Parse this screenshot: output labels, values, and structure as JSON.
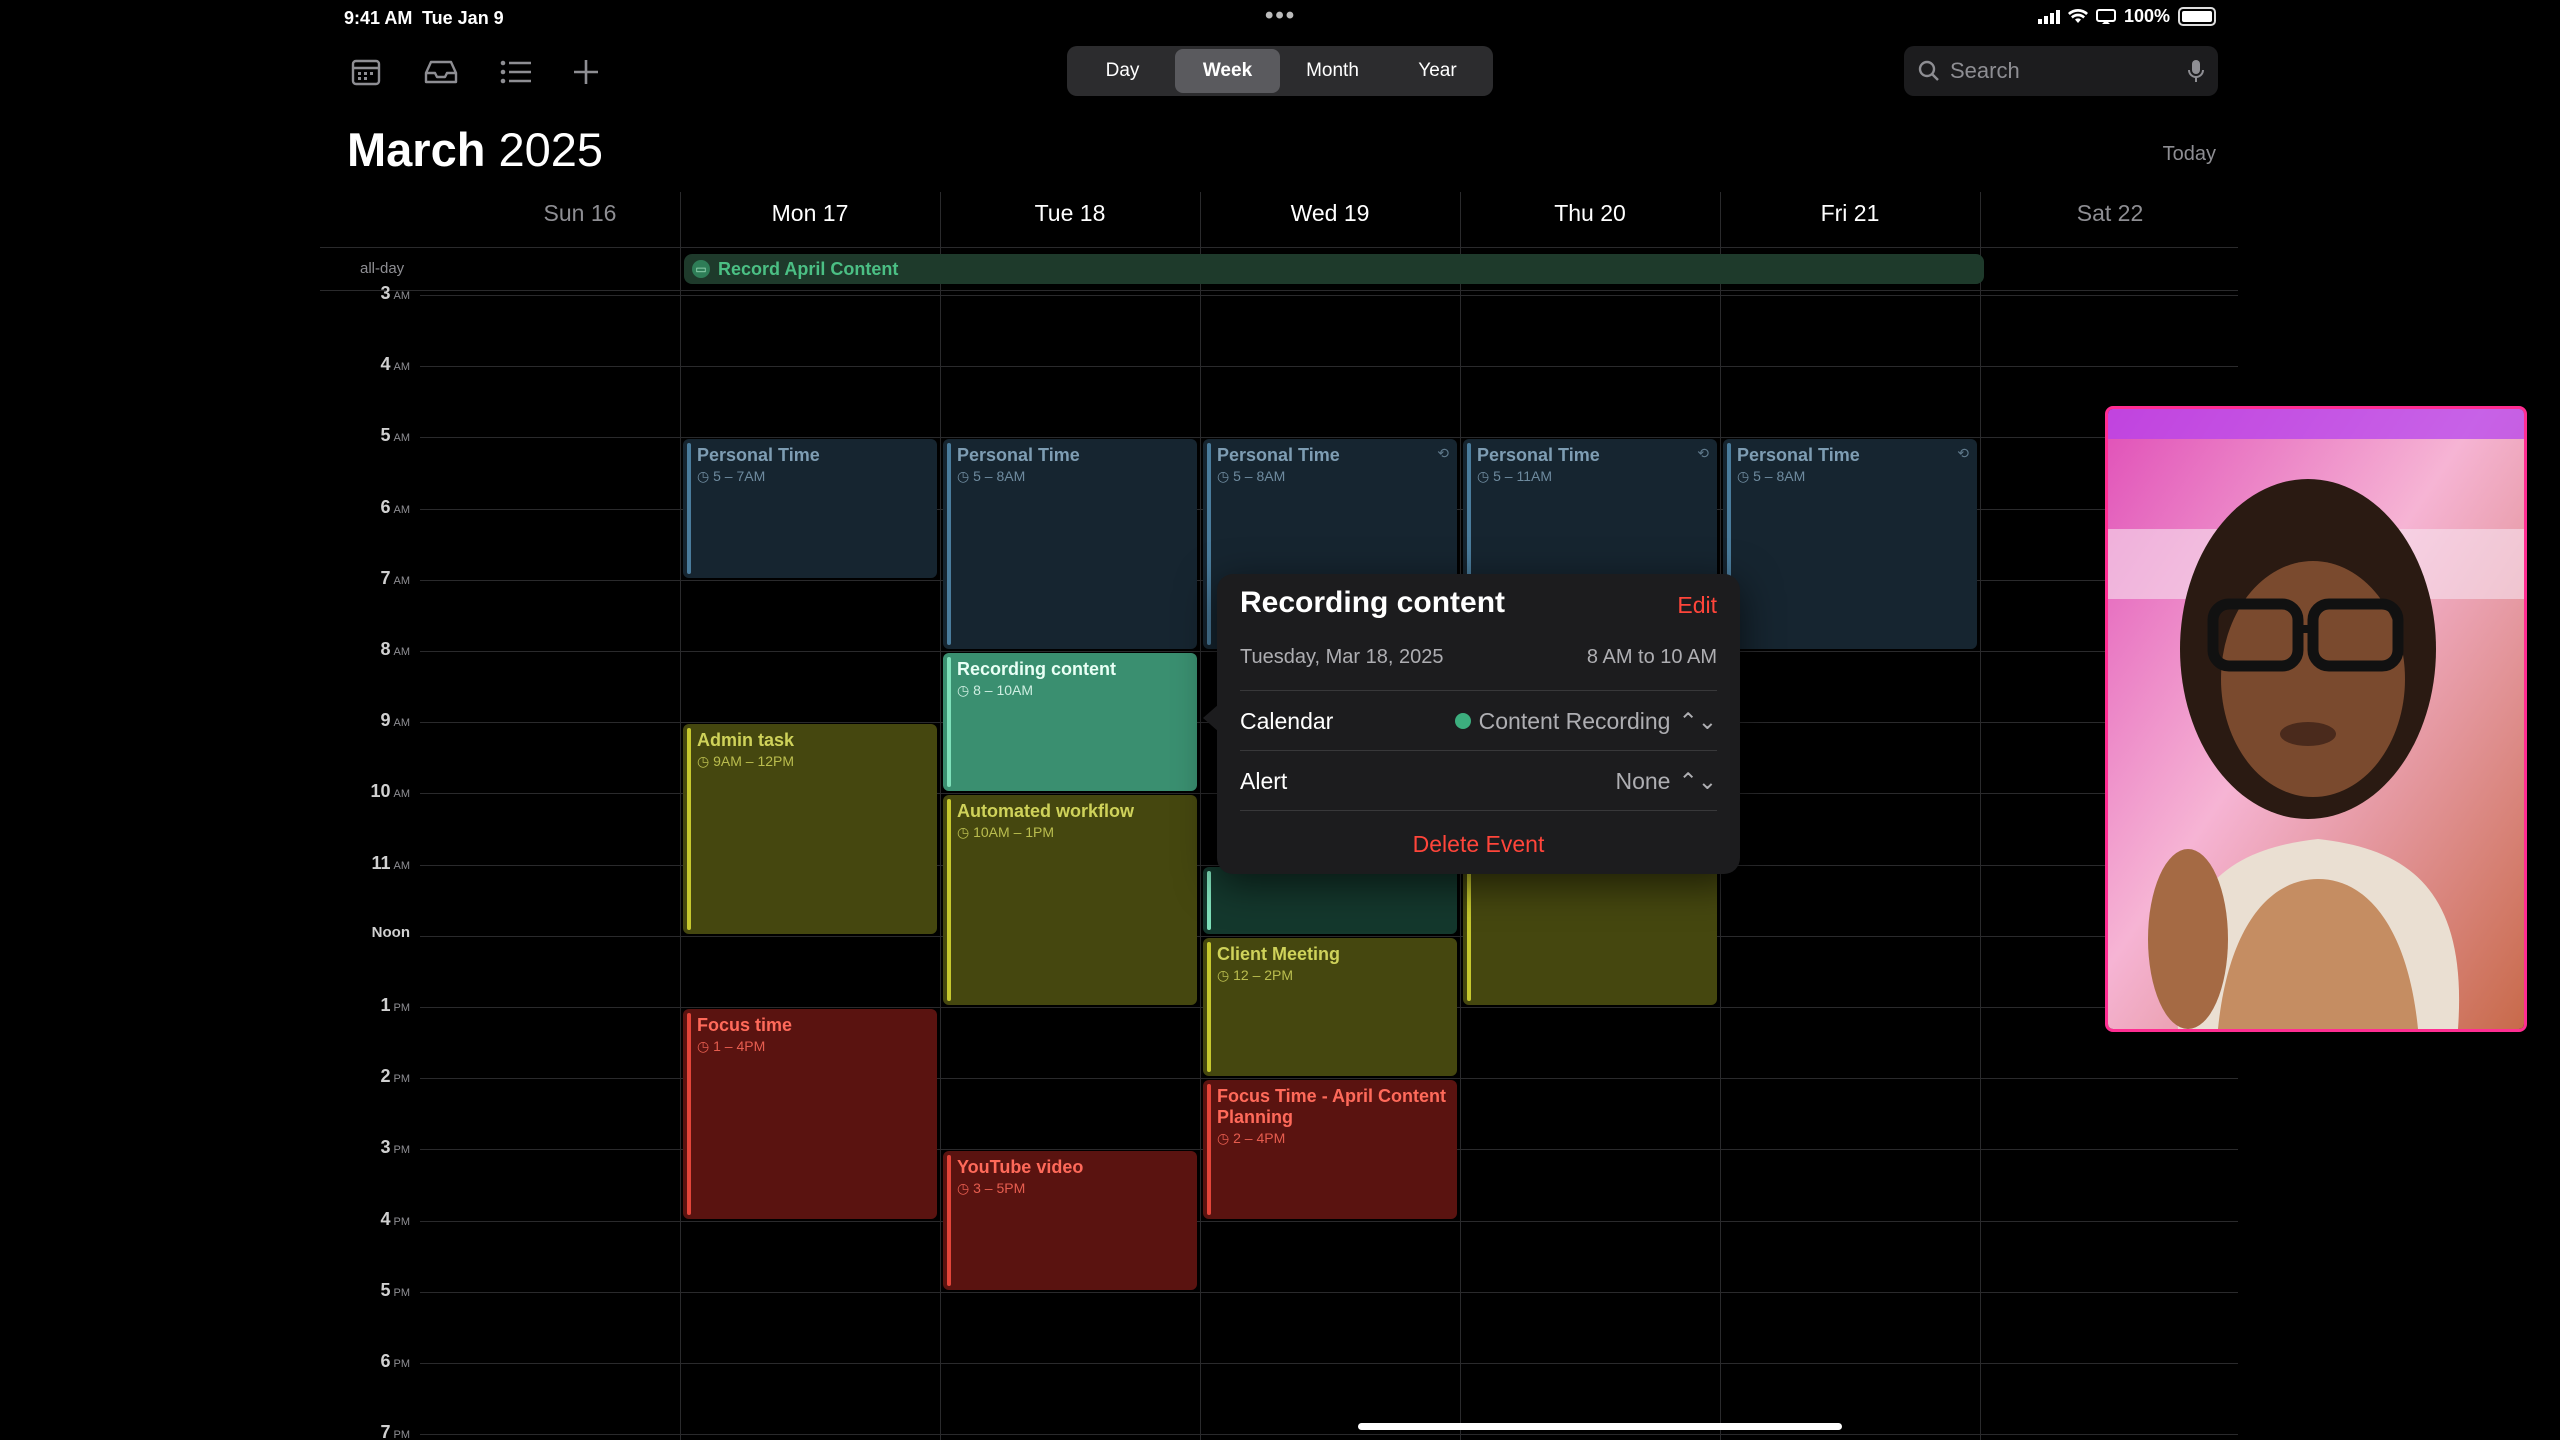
{
  "status": {
    "time": "9:41 AM",
    "date": "Tue Jan 9",
    "battery": "100%"
  },
  "toolbar": {
    "icons": [
      "calendar-icon",
      "inbox-icon",
      "list-icon",
      "plus-icon"
    ],
    "segments": [
      "Day",
      "Week",
      "Month",
      "Year"
    ],
    "active_segment": "Week",
    "search_placeholder": "Search"
  },
  "header": {
    "month": "March",
    "year": "2025",
    "today": "Today"
  },
  "days": [
    "Sun 16",
    "Mon 17",
    "Tue 18",
    "Wed 19",
    "Thu 20",
    "Fri 21",
    "Sat 22"
  ],
  "allday": {
    "label": "all-day",
    "event": "Record April Content"
  },
  "hours": [
    {
      "n": "3",
      "s": "AM"
    },
    {
      "n": "4",
      "s": "AM"
    },
    {
      "n": "5",
      "s": "AM"
    },
    {
      "n": "6",
      "s": "AM"
    },
    {
      "n": "7",
      "s": "AM"
    },
    {
      "n": "8",
      "s": "AM"
    },
    {
      "n": "9",
      "s": "AM"
    },
    {
      "n": "10",
      "s": "AM"
    },
    {
      "n": "11",
      "s": "AM"
    },
    {
      "n": "Noon",
      "s": ""
    },
    {
      "n": "1",
      "s": "PM"
    },
    {
      "n": "2",
      "s": "PM"
    },
    {
      "n": "3",
      "s": "PM"
    },
    {
      "n": "4",
      "s": "PM"
    },
    {
      "n": "5",
      "s": "PM"
    },
    {
      "n": "6",
      "s": "PM"
    },
    {
      "n": "7",
      "s": "PM"
    }
  ],
  "events": [
    {
      "day": 1,
      "start": 5,
      "end": 7,
      "title": "Personal Time",
      "time": "5 – 7AM",
      "color": "blue",
      "repeat": false
    },
    {
      "day": 2,
      "start": 5,
      "end": 8,
      "title": "Personal Time",
      "time": "5 – 8AM",
      "color": "blue",
      "repeat": false
    },
    {
      "day": 3,
      "start": 5,
      "end": 8,
      "title": "Personal Time",
      "time": "5 – 8AM",
      "color": "blue",
      "repeat": true
    },
    {
      "day": 4,
      "start": 5,
      "end": 8,
      "title": "Personal Time",
      "time": "5 – 11AM",
      "color": "blue",
      "repeat": true
    },
    {
      "day": 5,
      "start": 5,
      "end": 8,
      "title": "Personal Time",
      "time": "5 – 8AM",
      "color": "blue",
      "repeat": true
    },
    {
      "day": 1,
      "start": 9,
      "end": 12,
      "title": "Admin task",
      "time": "9AM – 12PM",
      "color": "olive",
      "repeat": false
    },
    {
      "day": 2,
      "start": 8,
      "end": 10,
      "title": "Recording content",
      "time": "8 – 10AM",
      "color": "teal",
      "repeat": false
    },
    {
      "day": 2,
      "start": 10,
      "end": 13,
      "title": "Automated workflow",
      "time": "10AM – 1PM",
      "color": "olive",
      "repeat": false
    },
    {
      "day": 3,
      "start": 11,
      "end": 12,
      "title": "",
      "time": "",
      "color": "teal-dark",
      "repeat": false
    },
    {
      "day": 4,
      "start": 11,
      "end": 13,
      "title": "",
      "time": "",
      "color": "olive",
      "repeat": false
    },
    {
      "day": 3,
      "start": 12,
      "end": 14,
      "title": "Client Meeting",
      "time": "12 – 2PM",
      "color": "olive",
      "repeat": false
    },
    {
      "day": 1,
      "start": 13,
      "end": 16,
      "title": "Focus time",
      "time": "1 – 4PM",
      "color": "red",
      "repeat": false
    },
    {
      "day": 3,
      "start": 14,
      "end": 16,
      "title": "Focus Time - April Content Planning",
      "time": "2 – 4PM",
      "color": "red",
      "repeat": false
    },
    {
      "day": 2,
      "start": 15,
      "end": 17,
      "title": "YouTube video",
      "time": "3 – 5PM",
      "color": "red",
      "repeat": false
    }
  ],
  "popover": {
    "title": "Recording content",
    "edit": "Edit",
    "date": "Tuesday, Mar 18, 2025",
    "range": "8 AM to 10 AM",
    "calendar_label": "Calendar",
    "calendar_value": "Content Recording",
    "alert_label": "Alert",
    "alert_value": "None",
    "delete": "Delete Event"
  }
}
